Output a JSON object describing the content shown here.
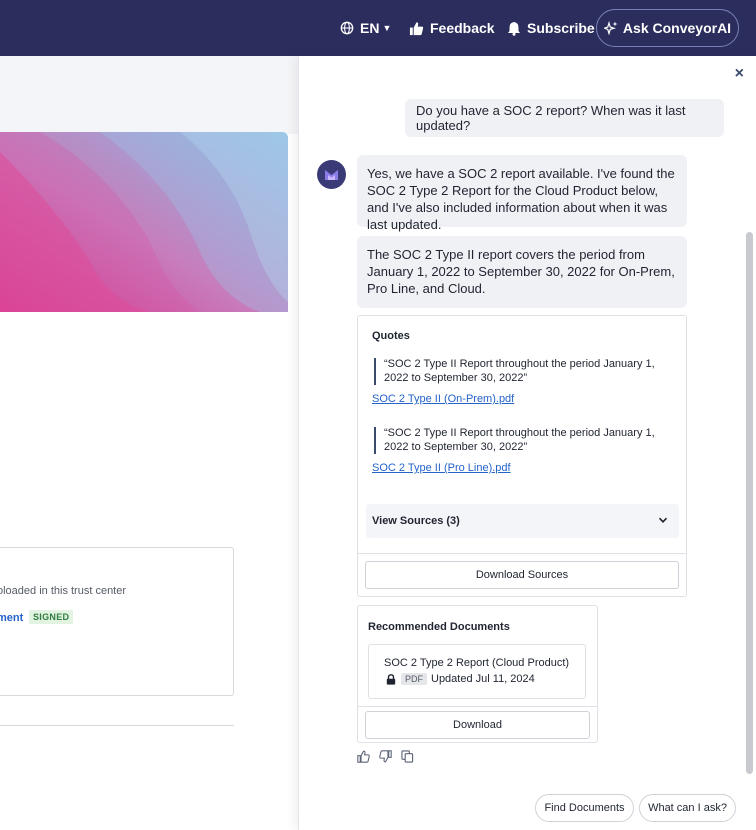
{
  "colors": {
    "nav_bg": "#2b2d5c",
    "link": "#2563c9",
    "bubble_bg": "#f0f1f5",
    "badge_green": "#2f7d3d"
  },
  "topbar": {
    "language": "EN",
    "feedback_label": "Feedback",
    "subscribe_label": "Subscribe",
    "ask_label": "Ask ConveyorAI",
    "icons": [
      "globe-icon",
      "thumbs-up-icon",
      "bell-icon",
      "sparkle-icon"
    ]
  },
  "background_page": {
    "box_text": "oloaded in this trust center",
    "box_link": "ment",
    "badge": "SIGNED"
  },
  "chat": {
    "user_message": "Do you have a SOC 2 report? When was it last updated?",
    "bot_messages": [
      "Yes, we have a SOC 2 report available. I've found the SOC 2 Type 2 Report for the Cloud Product below, and I've also included information about when it was last updated.",
      "The SOC 2 Type II report covers the period from January 1, 2022 to September 30, 2022 for On-Prem, Pro Line, and Cloud."
    ],
    "quotes": {
      "title": "Quotes",
      "items": [
        {
          "text": "“SOC 2 Type II Report throughout the period January 1, 2022 to September 30, 2022”",
          "link": "SOC 2 Type II (On-Prem).pdf"
        },
        {
          "text": "“SOC 2 Type II Report throughout the period January 1, 2022 to September 30, 2022”",
          "link": "SOC 2 Type II (Pro Line).pdf"
        }
      ],
      "view_sources_label": "View Sources (3)",
      "download_sources_label": "Download Sources"
    },
    "recommended": {
      "title": "Recommended Documents",
      "document_name": "SOC 2 Type 2 Report (Cloud Product)",
      "file_type": "PDF",
      "updated": "Updated Jul 11, 2024",
      "download_label": "Download"
    },
    "suggestions": [
      "Find Documents",
      "What can I ask?"
    ],
    "close_label": "×"
  }
}
